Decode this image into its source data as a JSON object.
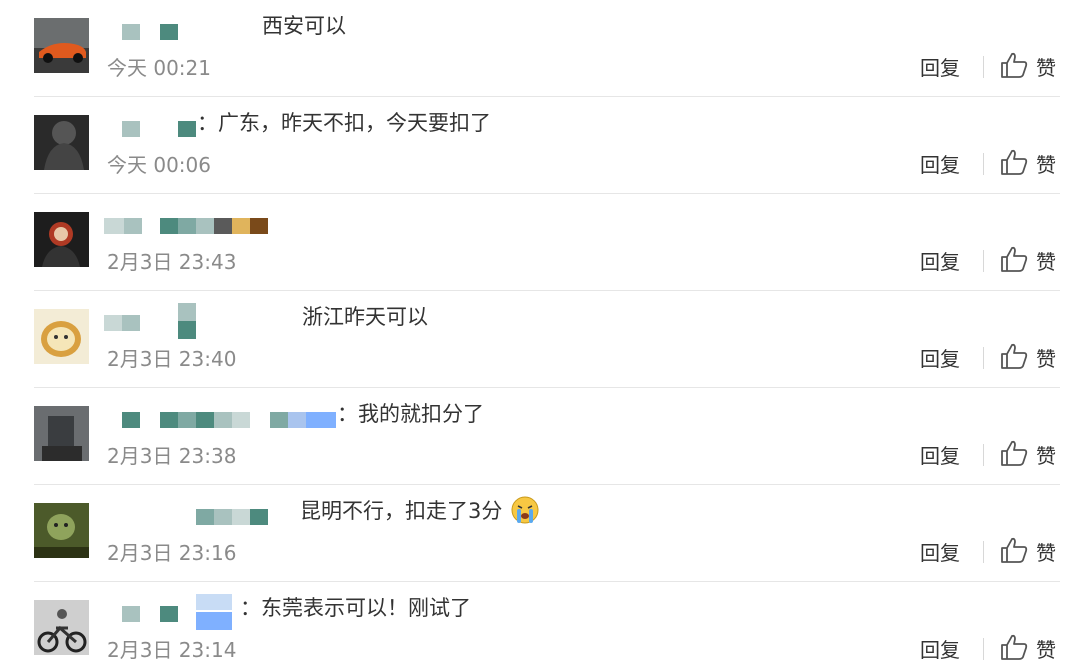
{
  "comments": [
    {
      "text": "西安可以",
      "time": "今天 00:21",
      "reply": "回复",
      "like": "赞"
    },
    {
      "text": "：广东，昨天不扣，今天要扣了",
      "time": "今天 00:06",
      "reply": "回复",
      "like": "赞"
    },
    {
      "text": "",
      "time": "2月3日 23:43",
      "reply": "回复",
      "like": "赞"
    },
    {
      "text": "浙江昨天可以",
      "time": "2月3日 23:40",
      "reply": "回复",
      "like": "赞"
    },
    {
      "text": "：我的就扣分了",
      "time": "2月3日 23:38",
      "reply": "回复",
      "like": "赞"
    },
    {
      "text": "昆明不行，扣走了3分",
      "time": "2月3日 23:16",
      "reply": "回复",
      "like": "赞"
    },
    {
      "text": "：东莞表示可以！刚试了",
      "time": "2月3日 23:14",
      "reply": "回复",
      "like": "赞"
    }
  ],
  "icons": {
    "like": "thumbs-up-icon",
    "emoji": "crying-face-icon"
  },
  "colors": {
    "teal": "#4d8a7e",
    "grey_teal": "#a9c2bf",
    "time": "#8a8a8a",
    "divider": "#e6e6e6"
  }
}
